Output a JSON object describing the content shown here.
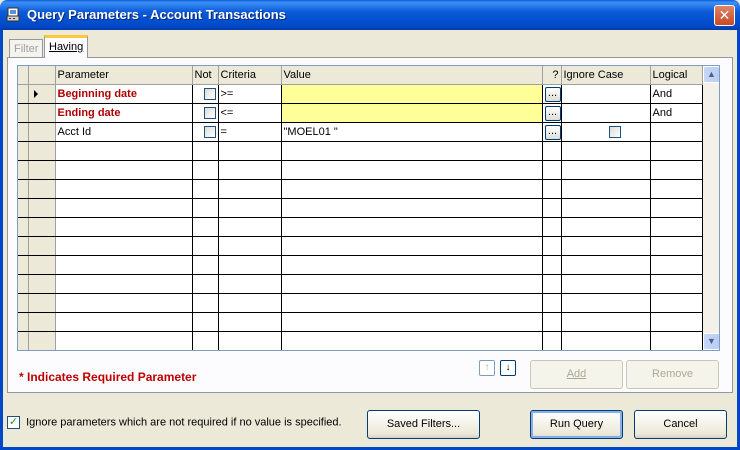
{
  "window": {
    "title": "Query Parameters - Account Transactions",
    "close_label": "✕"
  },
  "tabs": {
    "filter": "Filter",
    "having": "Having"
  },
  "grid": {
    "columns": [
      "",
      "Parameter",
      "Not",
      "Criteria",
      "Value",
      "?",
      "Ignore Case",
      "Logical"
    ],
    "rows": [
      {
        "parameter": "Beginning date",
        "required": true,
        "criteria": ">=",
        "value": "",
        "logical": "And",
        "current": true,
        "ignore_case_checkbox": false
      },
      {
        "parameter": "Ending date",
        "required": true,
        "criteria": "<=",
        "value": "",
        "logical": "And",
        "current": false,
        "ignore_case_checkbox": false
      },
      {
        "parameter": "Acct Id",
        "required": false,
        "criteria": "=",
        "value": "\"MOEL01        \"",
        "logical": "",
        "current": false,
        "ignore_case_checkbox": true
      }
    ],
    "ellipsis_label": "...",
    "empty_rows": 11
  },
  "required_note": "* Indicates Required Parameter",
  "buttons": {
    "add": "Add",
    "remove": "Remove",
    "saved_filters": "Saved Filters...",
    "run_query": "Run Query",
    "cancel": "Cancel",
    "move_up": "↑",
    "move_down": "↓"
  },
  "ignore_checkbox": {
    "label": "Ignore parameters which are not required if no value is specified.",
    "checked": true,
    "mark": "✓"
  },
  "colors": {
    "required_text": "#b00000",
    "value_highlight": "#ffff99",
    "titlebar": "#0048c8"
  }
}
